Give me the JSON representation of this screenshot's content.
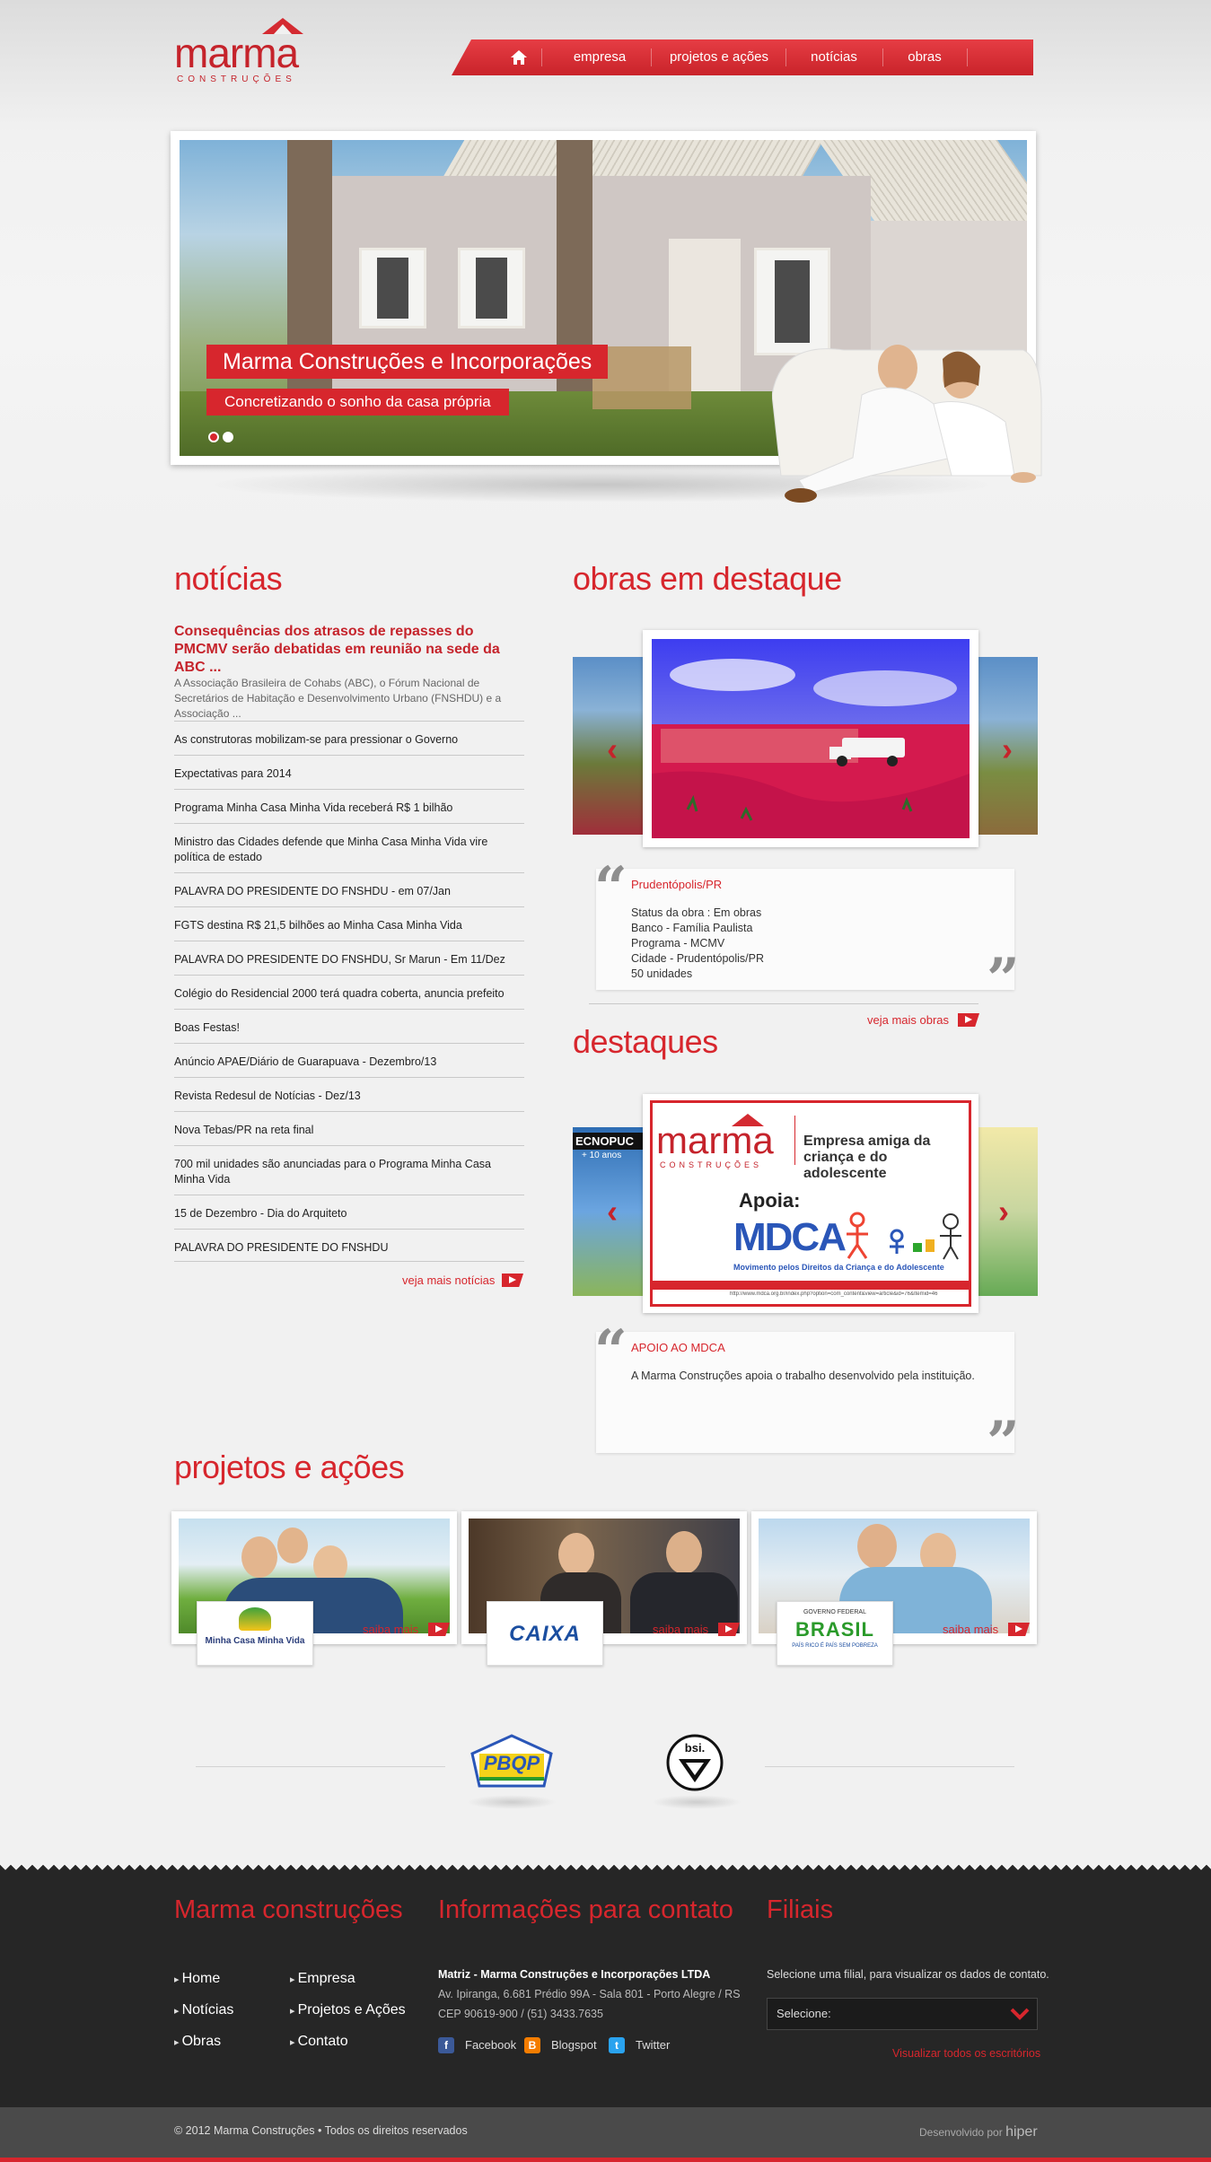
{
  "brand": {
    "name": "marma",
    "sub": "CONSTRUÇÕES"
  },
  "nav": {
    "home_icon": "home-icon",
    "items": [
      "empresa",
      "projetos e ações",
      "notícias",
      "obras"
    ]
  },
  "slider": {
    "title": "Marma Construções e Incorporações",
    "subtitle": "Concretizando o sonho da casa própria",
    "dots": 2,
    "active_dot": 1
  },
  "noticias": {
    "heading": "notícias",
    "lead_title": "Consequências dos atrasos de repasses do PMCMV serão debatidas em reunião na sede da ABC ...",
    "lead_body": "A Associação Brasileira de Cohabs (ABC), o Fórum Nacional de Secretários de Habitação e Desenvolvimento Urbano (FNSHDU) e a Associação ...",
    "items": [
      "As construtoras mobilizam-se para pressionar o Governo",
      "Expectativas para 2014",
      "Programa Minha Casa Minha Vida receberá R$ 1 bilhão",
      "Ministro das Cidades defende que Minha Casa Minha Vida vire política de estado",
      "PALAVRA DO PRESIDENTE DO FNSHDU - em 07/Jan",
      "FGTS destina R$ 21,5 bilhões ao Minha Casa Minha Vida",
      "PALAVRA DO PRESIDENTE DO FNSHDU, Sr Marun - Em 11/Dez",
      "Colégio do Residencial 2000 terá quadra coberta, anuncia prefeito",
      "Boas Festas!",
      "Anúncio APAE/Diário de Guarapuava - Dezembro/13",
      "Revista Redesul de Notícias - Dez/13",
      "Nova Tebas/PR na reta final",
      "700 mil unidades são anunciadas para o Programa Minha Casa Minha Vida",
      "15 de Dezembro - Dia do Arquiteto",
      "PALAVRA DO PRESIDENTE DO FNSHDU"
    ],
    "more": "veja mais notícias"
  },
  "obras": {
    "heading": "obras em destaque",
    "card_title": "Prudentópolis/PR",
    "card_body": "Status da obra : Em obras\nBanco - Família Paulista\nPrograma - MCMV\nCidade - Prudentópolis/PR\n50 unidades",
    "more": "veja mais obras"
  },
  "destaques": {
    "heading": "destaques",
    "banner_brand": "marma",
    "banner_brand_sub": "CONSTRUÇÕES",
    "banner_headline": "Empresa amiga da criança e do adolescente",
    "banner_apoia": "Apoia:",
    "banner_logo": "MDCA",
    "banner_caption": "Movimento pelos Direitos da Criança e do Adolescente",
    "banner_url": "http://www.mdca.org.br/index.php?option=com_content&view=article&id=76&Itemid=46",
    "side_left_text": "ECNOPUC",
    "side_left_sub": "+ 10 anos",
    "card_title": "APOIO AO MDCA",
    "card_body": "A Marma Construções apoia o trabalho desenvolvido pela instituição."
  },
  "projetos": {
    "heading": "projetos e ações",
    "cards": [
      {
        "logo": "Minha Casa Minha Vida",
        "more": "saiba mais"
      },
      {
        "logo": "CAIXA",
        "more": "saiba mais"
      },
      {
        "logo": "BRASIL",
        "logo_sub": "PAÍS RICO É PAÍS SEM POBREZA",
        "logo_top": "GOVERNO FEDERAL",
        "more": "saiba mais"
      }
    ]
  },
  "certs": {
    "pbqp": "PBQP",
    "bsi": "bsi."
  },
  "footer": {
    "col1_heading": "Marma construções",
    "links_left": [
      "Home",
      "Notícias",
      "Obras"
    ],
    "links_right": [
      "Empresa",
      "Projetos e Ações",
      "Contato"
    ],
    "col2_heading": "Informações para contato",
    "company": "Matriz - Marma Construções e Incorporações LTDA",
    "address": "Av. Ipiranga, 6.681 Prédio 99A - Sala 801 - Porto Alegre / RS",
    "cep": "CEP 90619-900 / (51) 3433.7635",
    "social": [
      "Facebook",
      "Blogspot",
      "Twitter"
    ],
    "col3_heading": "Filiais",
    "filial_text": "Selecione uma filial, para visualizar os dados de contato.",
    "filial_select": "Selecione:",
    "all_offices": "Visualizar todos os escritórios",
    "copyright": "© 2012 Marma Construções • Todos os direitos reservados",
    "dev_label": "Desenvolvido por",
    "dev_name": "hiper"
  },
  "colors": {
    "accent": "#d7262d",
    "footer_bg": "#262626",
    "bottom_bar": "#4a4a4a"
  }
}
